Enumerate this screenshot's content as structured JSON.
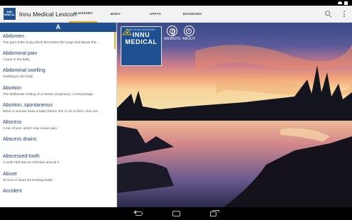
{
  "status": {
    "battery": "",
    "time": ""
  },
  "app_bar": {
    "logo_line1": "INNU",
    "logo_line2": "MEDICAL",
    "title": "Innu Medical Lexicon",
    "tabs": [
      {
        "label": "GLOSSARY",
        "active": true
      },
      {
        "label": "BODY",
        "active": false
      },
      {
        "label": "APPTA",
        "active": false
      },
      {
        "label": "DIAGRAMS",
        "active": false
      }
    ],
    "search_icon": "search-icon",
    "overflow_icon": "overflow-menu-icon"
  },
  "glossary": {
    "letter": "A",
    "entries": [
      {
        "term": "Abdomen",
        "definition": "The part of the body which lies below the lungs and above the..."
      },
      {
        "term": "Abdominal pain",
        "definition": "A pain in the belly."
      },
      {
        "term": "Abdominal swelling",
        "definition": "Swelling in the belly."
      },
      {
        "term": "Abortion",
        "definition": "The deliberate ending of a human pregnancy; a miscarriage."
      },
      {
        "term": "Abortion, spontaneous",
        "definition": "When a woman loses a baby before she or he is born. Also cal..."
      },
      {
        "term": "Abscess",
        "definition": "A sac of pus, which may cause pain."
      },
      {
        "term": "Abscess drains",
        "definition": ""
      },
      {
        "term": "Abscessed tooth",
        "definition": "A tooth that has an infection around it."
      },
      {
        "term": "Abuse",
        "definition": "To hurt or injure by treating badly."
      },
      {
        "term": "Accident",
        "definition": ""
      }
    ]
  },
  "brand": {
    "small_text": "INATUKUM-AUSHTAKA",
    "name_line1": "INNU",
    "name_line2": "MEDICAL"
  },
  "buttons": {
    "website_label": "WEBSITE",
    "about_label": "ABOUT"
  },
  "colors": {
    "primary": "#1d4f91",
    "accent": "#d7a51f",
    "sky_top": "#3a4a86",
    "sunset": "#e98a6a"
  }
}
